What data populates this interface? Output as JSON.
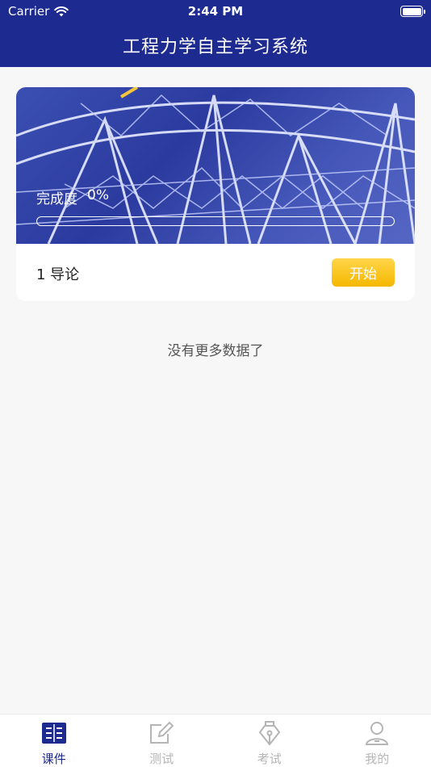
{
  "status_bar": {
    "carrier": "Carrier",
    "time": "2:44 PM",
    "icons": [
      "wifi-icon",
      "battery-icon"
    ]
  },
  "header": {
    "title": "工程力学自主学习系统"
  },
  "course_card": {
    "progress_label": "完成度",
    "progress_text": "0%",
    "progress_value": 0,
    "lesson_title": "1 导论",
    "start_button": "开始"
  },
  "list": {
    "end_message": "没有更多数据了"
  },
  "tabbar": {
    "tabs": [
      {
        "label": "课件",
        "icon": "book-icon",
        "active": true
      },
      {
        "label": "测试",
        "icon": "edit-icon",
        "active": false
      },
      {
        "label": "考试",
        "icon": "pen-nib-icon",
        "active": false
      },
      {
        "label": "我的",
        "icon": "user-icon",
        "active": false
      }
    ]
  },
  "colors": {
    "primary": "#1d2a8f",
    "accent": "#f5b800",
    "inactive": "#b5b5b5",
    "background": "#f7f7f7"
  }
}
